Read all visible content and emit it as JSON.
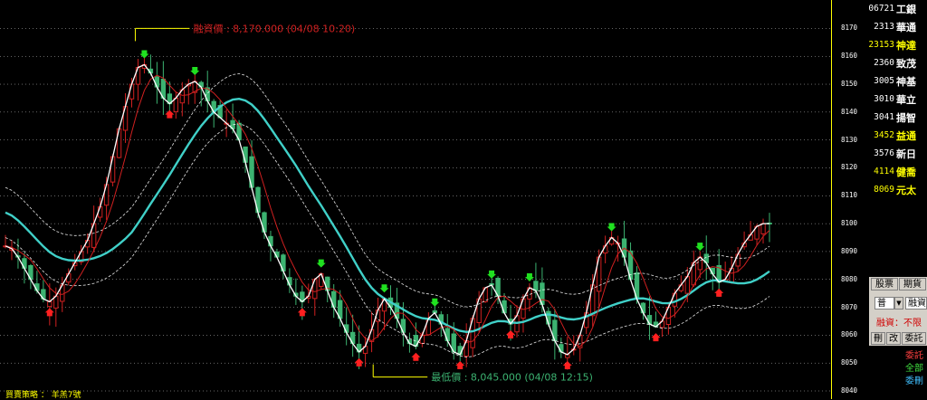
{
  "chart_data": {
    "type": "line",
    "ylim": [
      8040,
      8175
    ],
    "yticks": [
      8040,
      8050,
      8060,
      8070,
      8080,
      8090,
      8100,
      8110,
      8120,
      8130,
      8140,
      8150,
      8160,
      8170
    ],
    "high_annotation": "融資價 : 8,170.000 (04/08 10:20)",
    "low_annotation": "最低價 : 8,045.000 (04/08 12:15)",
    "series": [
      {
        "values": [
          8092,
          8091,
          8088,
          8084,
          8080,
          8076,
          8073,
          8072,
          8074,
          8078,
          8082,
          8086,
          8090,
          8094,
          8100,
          8106,
          8114,
          8124,
          8134,
          8142,
          8150,
          8156,
          8157,
          8154,
          8149,
          8145,
          8143,
          8145,
          8148,
          8150,
          8151,
          8149,
          8144,
          8140,
          8138,
          8136,
          8134,
          8130,
          8122,
          8113,
          8104,
          8097,
          8092,
          8088,
          8083,
          8078,
          8074,
          8072,
          8074,
          8080,
          8082,
          8076,
          8070,
          8066,
          8061,
          8057,
          8054,
          8056,
          8062,
          8069,
          8073,
          8070,
          8066,
          8061,
          8057,
          8056,
          8060,
          8066,
          8068,
          8064,
          8058,
          8054,
          8053,
          8058,
          8066,
          8073,
          8077,
          8078,
          8074,
          8068,
          8064,
          8067,
          8073,
          8077,
          8076,
          8071,
          8064,
          8058,
          8054,
          8053,
          8055,
          8060,
          8068,
          8078,
          8088,
          8092,
          8095,
          8093,
          8088,
          8080,
          8073,
          8068,
          8064,
          8063,
          8065,
          8070,
          8075,
          8078,
          8081,
          8086,
          8088,
          8086,
          8082,
          8079,
          8080,
          8084,
          8089,
          8093,
          8096,
          8099,
          8100,
          8100
        ]
      }
    ],
    "colors": {
      "price": "#ffffff",
      "fast": "#d02020",
      "slow": "#40d0c8",
      "band": "#ffffff",
      "up": "#d02020",
      "down": "#3cb371",
      "buy": "#ff2020",
      "sell": "#20e020",
      "grid": "#ffffff",
      "accent": "#ffff00"
    }
  },
  "watchlist": [
    {
      "code": "06721",
      "name": "工銀",
      "color": "#ffffff"
    },
    {
      "code": "2313",
      "name": "華通",
      "color": "#ffffff"
    },
    {
      "code": "23153",
      "name": "神達",
      "color": "#ffff00"
    },
    {
      "code": "2360",
      "name": "致茂",
      "color": "#ffffff"
    },
    {
      "code": "3005",
      "name": "神基",
      "color": "#ffffff"
    },
    {
      "code": "3010",
      "name": "華立",
      "color": "#ffffff"
    },
    {
      "code": "3041",
      "name": "揚智",
      "color": "#ffffff"
    },
    {
      "code": "3452",
      "name": "益通",
      "color": "#ffff00"
    },
    {
      "code": "3576",
      "name": "新日",
      "color": "#ffffff"
    },
    {
      "code": "4114",
      "name": "健喬",
      "color": "#ffff00"
    },
    {
      "code": "8069",
      "name": "元太",
      "color": "#ffff00"
    }
  ],
  "tabs": {
    "stock": "股票",
    "futures": "期貨"
  },
  "order": {
    "type": "普",
    "arrow": "▼",
    "credit": "融資",
    "margin_status": "融資：不限"
  },
  "ops": {
    "del": "刪",
    "mod": "改",
    "order_book": "委託"
  },
  "order_list": [
    {
      "label": "委託",
      "color": "#ff4040"
    },
    {
      "label": "全部",
      "color": "#40e040"
    },
    {
      "label": "委刪",
      "color": "#40c0ff"
    }
  ],
  "strategy": "買賣策略 ： 羊羔7號"
}
